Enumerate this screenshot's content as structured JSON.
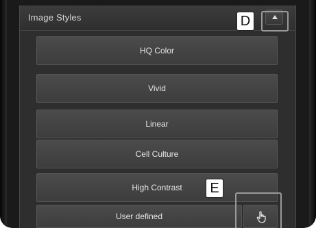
{
  "panel": {
    "title": "Image Styles",
    "collapse_icon": "caret-up-icon"
  },
  "styles": [
    {
      "label": "HQ Color"
    },
    {
      "label": "Vivid"
    },
    {
      "label": "Linear"
    },
    {
      "label": "Cell Culture"
    },
    {
      "label": "High Contrast"
    }
  ],
  "user_defined": {
    "label": "User defined",
    "icon": "hand-pointer-icon"
  },
  "markers": {
    "d": "D",
    "e": "E"
  }
}
